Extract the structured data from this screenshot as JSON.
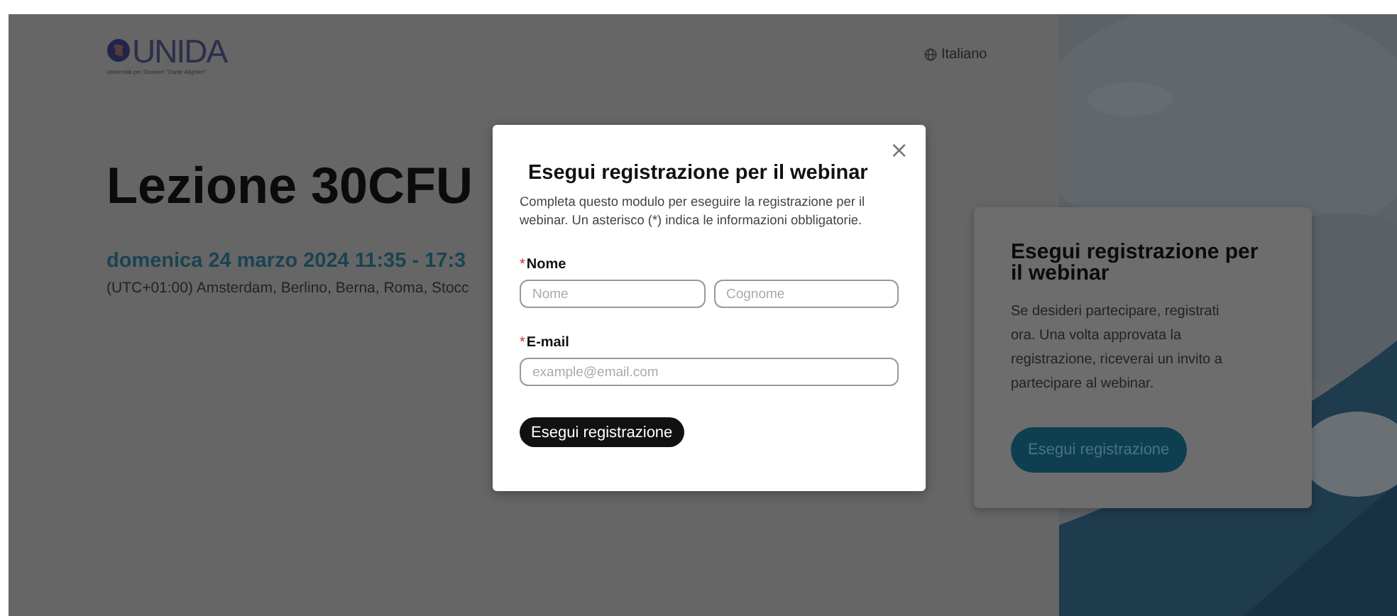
{
  "header": {
    "logo": {
      "wordmark": "UNIDA",
      "tagline": "Università per Stranieri \"Dante Alighieri\""
    },
    "language": "Italiano"
  },
  "event": {
    "title": "Lezione 30CFU",
    "date": "domenica 24 marzo 2024 11:35 - 17:3",
    "timezone": "(UTC+01:00) Amsterdam, Berlino, Berna, Roma, Stocc"
  },
  "side_card": {
    "title": "Esegui registrazione per il webinar",
    "text": "Se desideri partecipare, registrati ora. Una volta approvata la registrazione, riceverai un invito a partecipare al webinar.",
    "button": "Esegui registrazione"
  },
  "dialog": {
    "close": "×",
    "title": "Esegui registrazione per il webinar",
    "description": "Completa questo modulo per eseguire la registrazione per il webinar. Un asterisco (*) indica le informazioni obbligatorie.",
    "fields": [
      {
        "label": "Nome",
        "required": true,
        "asterisk": "*",
        "inputs": [
          {
            "placeholder": "Nome"
          },
          {
            "placeholder": "Cognome"
          }
        ]
      },
      {
        "label": "E-mail",
        "required": true,
        "asterisk": "*",
        "inputs": [
          {
            "placeholder": "example@email.com"
          }
        ]
      }
    ],
    "submit": "Esegui registrazione"
  }
}
